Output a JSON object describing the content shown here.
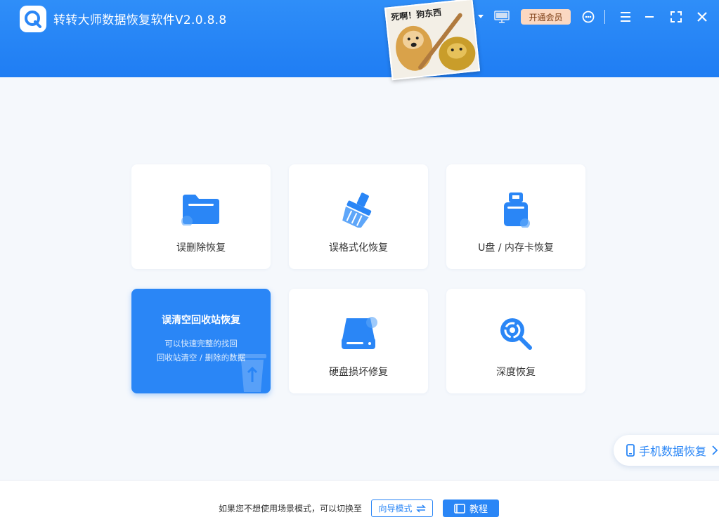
{
  "app": {
    "title": "转转大师数据恢复软件V2.0.8.8",
    "avatar_caption": "死啊！狗东西",
    "vip_label": "开通会员"
  },
  "icons": {
    "logo": "logo-icon",
    "dropdown": "chevron-down-icon",
    "monitor": "monitor-icon",
    "support": "headset-icon",
    "menu": "menu-icon",
    "minimize": "minimize-icon",
    "maximize": "maximize-icon",
    "close": "close-icon"
  },
  "cards": [
    {
      "label": "误删除恢复",
      "icon": "folder-icon"
    },
    {
      "label": "误格式化恢复",
      "icon": "broom-icon"
    },
    {
      "label": "U盘 / 内存卡恢复",
      "icon": "usb-drive-icon"
    },
    {
      "label": "误清空回收站恢复",
      "desc1": "可以快速完整的找回",
      "desc2": "回收站清空 / 删除的数据",
      "icon": "recycle-bin-icon"
    },
    {
      "label": "硬盘损坏修复",
      "icon": "hard-disk-icon"
    },
    {
      "label": "深度恢复",
      "icon": "search-icon"
    }
  ],
  "mobile": {
    "label": "手机数据恢复"
  },
  "footer": {
    "text": "如果您不想使用场景模式，可以切换至",
    "guide_label": "向导模式",
    "tutorial_label": "教程"
  },
  "colors": {
    "brand": "#2a86f6",
    "header": "#2f8ef8",
    "background": "#f5f8fc"
  }
}
